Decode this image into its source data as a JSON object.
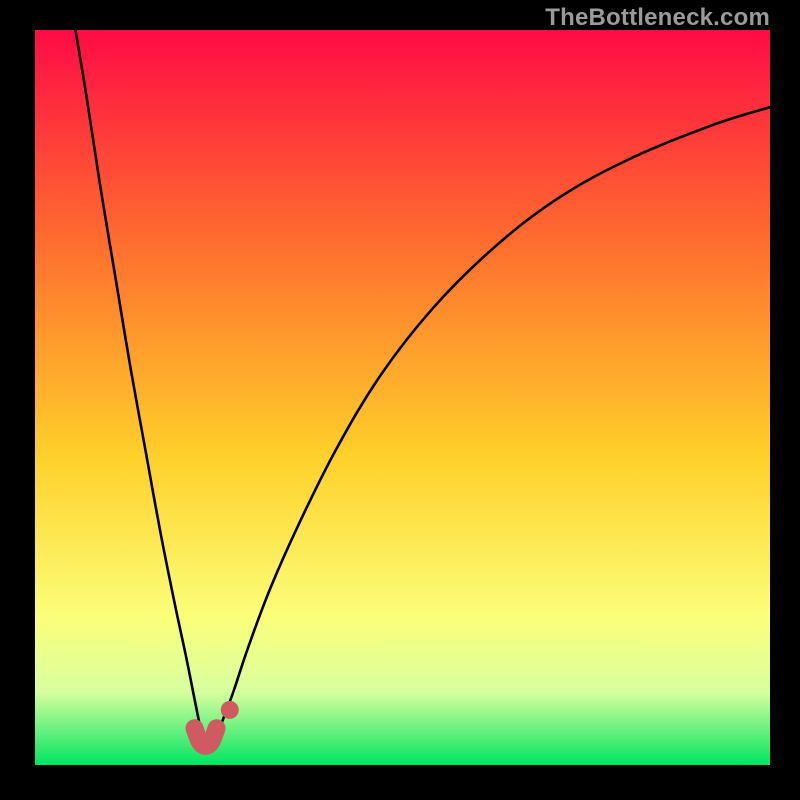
{
  "attribution": "TheBottleneck.com",
  "colors": {
    "frame": "#000000",
    "gradient_top": "#ff0b45",
    "gradient_mid_high": "#ff6a2f",
    "gradient_mid": "#ffd02a",
    "gradient_low": "#fbff7a",
    "gradient_band": "#d8ff9e",
    "gradient_bottom": "#00e562",
    "curve": "#000000",
    "marker": "#cf5a62"
  },
  "chart_data": {
    "type": "line",
    "title": "",
    "xlabel": "",
    "ylabel": "",
    "xlim": [
      0,
      100
    ],
    "ylim": [
      0,
      100
    ],
    "grid": false,
    "legend": false,
    "series": [
      {
        "name": "left-branch",
        "x": [
          5.5,
          7.0,
          9.0,
          11.0,
          13.0,
          15.0,
          17.0,
          19.0,
          20.5,
          21.5,
          22.3,
          22.8
        ],
        "values": [
          100,
          91,
          78,
          66,
          54,
          43,
          32,
          22,
          15,
          10,
          6,
          3.5
        ]
      },
      {
        "name": "right-branch",
        "x": [
          24.5,
          25.5,
          27.0,
          29.0,
          32.0,
          36.0,
          41.0,
          47.0,
          54.0,
          62.0,
          71.0,
          81.0,
          92.0,
          100.0
        ],
        "values": [
          3.5,
          6,
          10,
          16,
          24,
          33,
          43,
          53,
          62,
          70,
          77,
          82.5,
          87,
          89.5
        ]
      },
      {
        "name": "trough-u-marker",
        "x": [
          21.7,
          22.4,
          23.2,
          24.0,
          24.7
        ],
        "values": [
          5.0,
          3.2,
          2.6,
          3.2,
          5.0
        ]
      },
      {
        "name": "dot-marker",
        "x": [
          26.5
        ],
        "values": [
          7.5
        ]
      }
    ],
    "gradient_stops": [
      {
        "offset": 0.0,
        "color": "#ff0b45"
      },
      {
        "offset": 0.28,
        "color": "#ff6a2f"
      },
      {
        "offset": 0.58,
        "color": "#ffd02a"
      },
      {
        "offset": 0.8,
        "color": "#fbff7a"
      },
      {
        "offset": 0.9,
        "color": "#d8ff9e"
      },
      {
        "offset": 1.0,
        "color": "#00e562"
      }
    ]
  }
}
